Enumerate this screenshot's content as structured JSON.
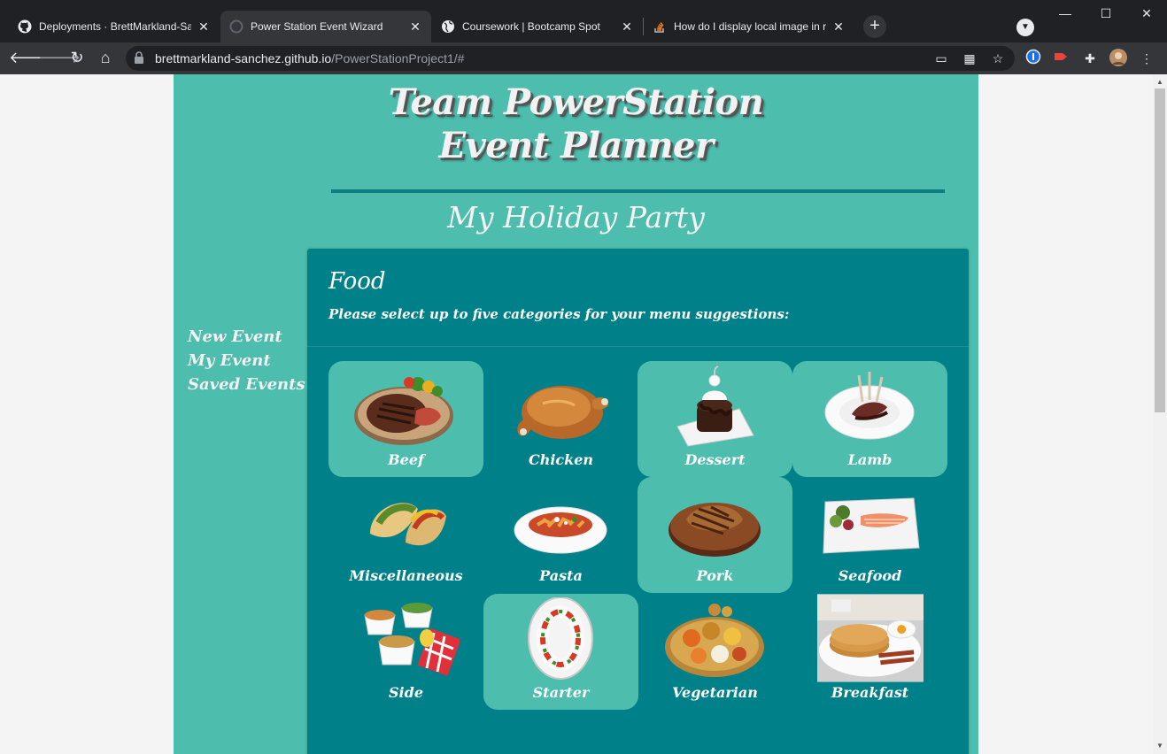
{
  "browser": {
    "tabs": [
      {
        "title": "Deployments · BrettMarkland-Sanchez",
        "icon": "github-icon",
        "active": false
      },
      {
        "title": "Power Station Event Wizard",
        "icon": "loading-globe-icon",
        "active": true
      },
      {
        "title": "Coursework | Bootcamp Spot",
        "icon": "globe-icon",
        "active": false
      },
      {
        "title": "How do I display local image in react",
        "icon": "stackoverflow-icon",
        "active": false
      }
    ],
    "url_host": "brettmarkland-sanchez.github.io",
    "url_path": "/PowerStationProject1/#",
    "colors": {
      "tabbar": "#202124",
      "toolbar": "#35363a"
    }
  },
  "site": {
    "logo_line1": "Team PowerStation",
    "logo_line2": "Event Planner",
    "event_name": "My Holiday Party",
    "nav": [
      {
        "label": "New Event"
      },
      {
        "label": "My Event"
      },
      {
        "label": "Saved Events"
      }
    ],
    "colors": {
      "page_bg": "#4dbdad",
      "card_bg": "#00818a",
      "selected_tile": "#4dbdad"
    }
  },
  "food": {
    "title": "Food",
    "subtitle": "Please select up to five categories for your menu suggestions:",
    "categories": [
      {
        "label": "Beef",
        "selected": true,
        "image": "steak-plate-image"
      },
      {
        "label": "Chicken",
        "selected": false,
        "image": "roast-chicken-image"
      },
      {
        "label": "Dessert",
        "selected": true,
        "image": "chocolate-cake-image"
      },
      {
        "label": "Lamb",
        "selected": true,
        "image": "lamb-rack-image"
      },
      {
        "label": "Miscellaneous",
        "selected": false,
        "image": "tacos-image"
      },
      {
        "label": "Pasta",
        "selected": false,
        "image": "penne-bowl-image"
      },
      {
        "label": "Pork",
        "selected": true,
        "image": "pork-chop-image"
      },
      {
        "label": "Seafood",
        "selected": false,
        "image": "salmon-plate-image"
      },
      {
        "label": "Side",
        "selected": false,
        "image": "side-dishes-image"
      },
      {
        "label": "Starter",
        "selected": true,
        "image": "caprese-image"
      },
      {
        "label": "Vegetarian",
        "selected": false,
        "image": "veg-platter-image"
      },
      {
        "label": "Breakfast",
        "selected": false,
        "image": "pancakes-eggs-image"
      }
    ]
  }
}
